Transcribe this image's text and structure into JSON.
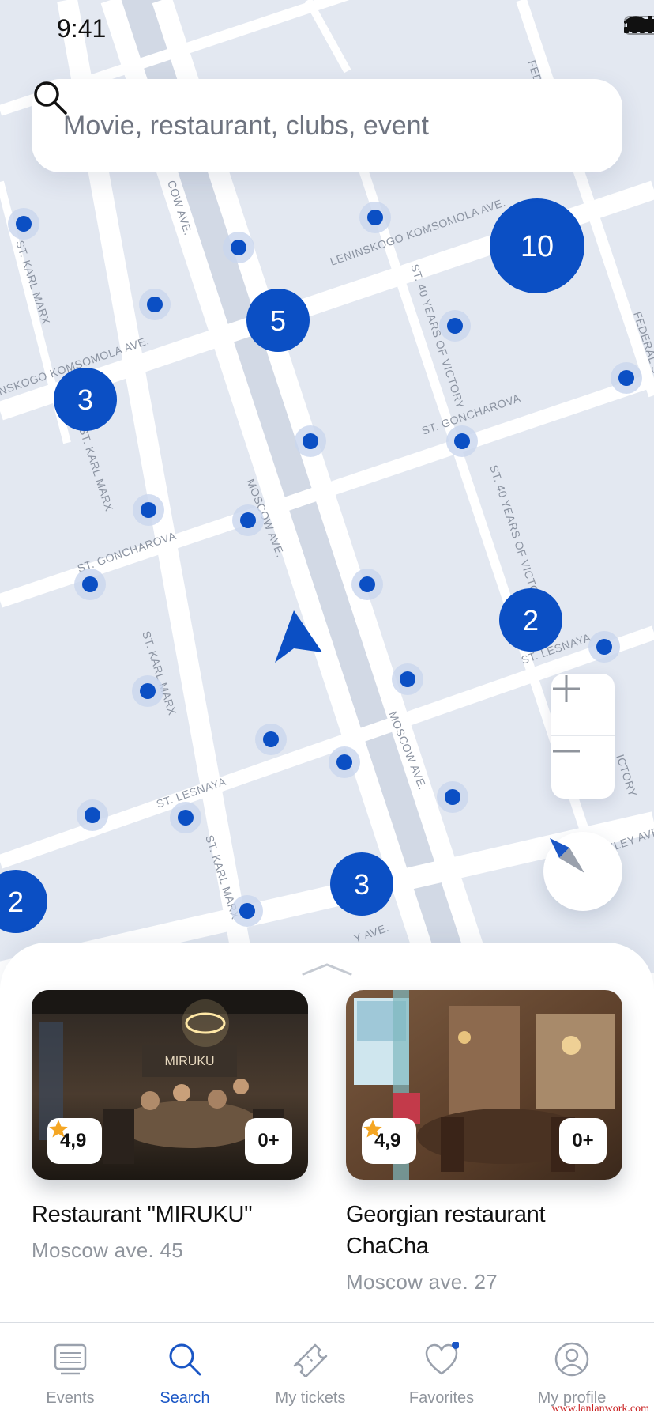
{
  "status_bar": {
    "time": "9:41"
  },
  "search": {
    "placeholder": "Movie, restaurant, clubs, event"
  },
  "map": {
    "street_labels": {
      "cow_ave": "COW AVE.",
      "fed": "FED",
      "leninskogo_komsomola": "LENINSKOGO KOMSOMOLA AVE.",
      "st_karl_marx_1": "ST. KARL MARX",
      "st_40_years_victory_1": "ST. 40 YEARS OF VICTORY",
      "federal": "FEDERAL ST.",
      "komsomola_left": "NSKOGO KOMSOMOLA AVE.",
      "st_goncharova_1": "ST. GONCHAROVA",
      "st_karl_marx_2": "ST. KARL MARX",
      "moscow_ave_1": "MOSCOW AVE.",
      "st_40_years_victory_2": "ST. 40 YEARS OF VICTORY",
      "st_goncharova_2": "ST. GONCHAROVA",
      "st_lesnaya_1": "ST. LESNAYA",
      "st_karl_marx_3": "ST. KARL MARX",
      "moscow_ave_2": "MOSCOW AVE.",
      "victory_right": "ICTORY",
      "st_lesnaya_2": "ST. LESNAYA",
      "st_karl_marx_4": "ST. KARL MARX",
      "eley_ave": "ELEY AVE",
      "bottom_ave": "Y AVE."
    },
    "clusters": [
      "10",
      "5",
      "3",
      "2",
      "3",
      "2"
    ]
  },
  "cards": [
    {
      "title": "Restaurant \"MIRUKU\"",
      "address": "Moscow ave. 45",
      "rating": "4,9",
      "age": "0+",
      "sign": "MIRUKU"
    },
    {
      "title": "Georgian restaurant ChaCha",
      "address": "Moscow ave. 27",
      "rating": "4,9",
      "age": "0+"
    }
  ],
  "tabs": [
    {
      "label": "Events",
      "icon": "events-icon"
    },
    {
      "label": "Search",
      "icon": "search-icon"
    },
    {
      "label": "My tickets",
      "icon": "ticket-icon"
    },
    {
      "label": "Favorites",
      "icon": "heart-icon"
    },
    {
      "label": "My profile",
      "icon": "profile-icon"
    }
  ],
  "watermark": "www.lanlanwork.com",
  "colors": {
    "accent": "#0b4fc4",
    "map_bg": "#e3e8f1",
    "road": "#ffffff",
    "secondary_text": "#8f949c"
  }
}
